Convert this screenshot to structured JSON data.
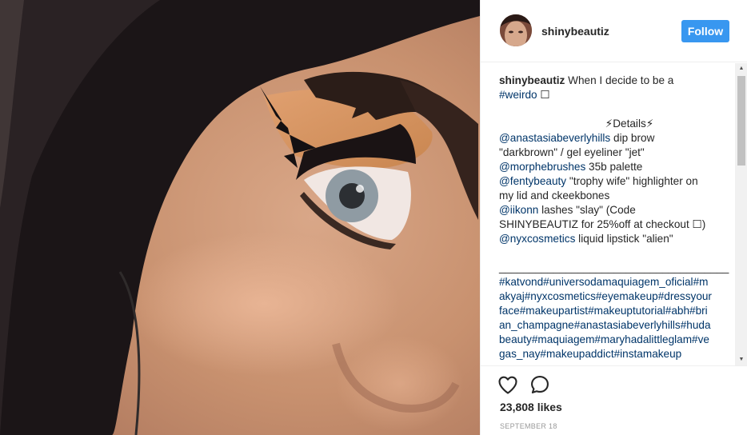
{
  "post": {
    "username": "shinybeautiz",
    "follow_label": "Follow",
    "caption": {
      "author": "shinybeautiz",
      "intro": "When I decide to be a",
      "intro_tag": "#weirdo",
      "intro_emoji": "☐",
      "details_heading": "⚡Details⚡",
      "lines": [
        {
          "mention": "@anastasiabeverlyhills",
          "text": " dip brow \"darkbrown\" / gel eyeliner \"jet\""
        },
        {
          "mention": "@morphebrushes",
          "text": " 35b palette"
        },
        {
          "mention": "@fentybeauty",
          "text": " \"trophy wife\" highlighter on my lid and ckeekbones"
        },
        {
          "mention": "@iikonn",
          "text": " lashes \"slay\" (Code SHINYBEAUTIZ for 25%off at checkout ☐)"
        },
        {
          "mention": "@nyxcosmetics",
          "text": " liquid lipstick \"alien\""
        }
      ],
      "separator": "______________________________________",
      "hashtags": "#katvond#universodamaquiagem_oficial#makyaj#nyxcosmetics#eyemakeup#dressyourface#makeupartist#makeuptutorial#abh#brian_champagne#anastasiabeverlyhills#hudabeauty#maquiagem#maryhadalittleglam#vegas_nay#makeupaddict#instamakeup"
    },
    "likes": "23,808 likes",
    "date": "SEPTEMBER 18"
  },
  "colors": {
    "follow_button": "#3897f0",
    "link": "#003569",
    "text": "#262626",
    "muted": "#999999"
  },
  "icons": {
    "like": "heart-outline",
    "comment": "speech-bubble-outline"
  }
}
